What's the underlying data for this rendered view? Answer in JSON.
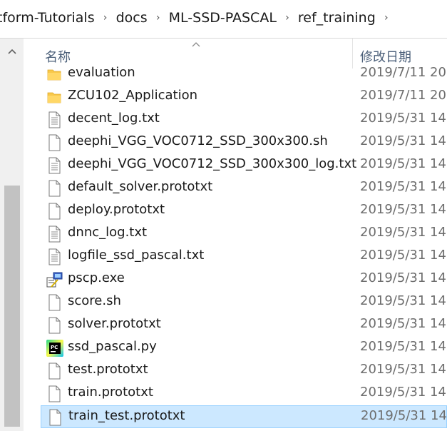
{
  "breadcrumb": [
    "tform-Tutorials",
    "docs",
    "ML-SSD-PASCAL",
    "ref_training"
  ],
  "breadcrumb_separator": "›",
  "columns": {
    "name": "名称",
    "date": "修改日期"
  },
  "files": [
    {
      "name": "evaluation",
      "date": "2019/7/11 20:",
      "icon": "folder-icon"
    },
    {
      "name": "ZCU102_Application",
      "date": "2019/7/11 20:",
      "icon": "folder-icon"
    },
    {
      "name": "decent_log.txt",
      "date": "2019/5/31 14:",
      "icon": "text-file-icon"
    },
    {
      "name": "deephi_VGG_VOC0712_SSD_300x300.sh",
      "date": "2019/5/31 14:",
      "icon": "blank-file-icon"
    },
    {
      "name": "deephi_VGG_VOC0712_SSD_300x300_log.txt",
      "date": "2019/5/31 14:",
      "icon": "text-file-icon"
    },
    {
      "name": "default_solver.prototxt",
      "date": "2019/5/31 14:",
      "icon": "blank-file-icon"
    },
    {
      "name": "deploy.prototxt",
      "date": "2019/5/31 14:",
      "icon": "blank-file-icon"
    },
    {
      "name": "dnnc_log.txt",
      "date": "2019/5/31 14:",
      "icon": "text-file-icon"
    },
    {
      "name": "logfile_ssd_pascal.txt",
      "date": "2019/5/31 14:",
      "icon": "text-file-icon"
    },
    {
      "name": "pscp.exe",
      "date": "2019/5/31 14:",
      "icon": "exe-icon"
    },
    {
      "name": "score.sh",
      "date": "2019/5/31 14:",
      "icon": "blank-file-icon"
    },
    {
      "name": "solver.prototxt",
      "date": "2019/5/31 14:",
      "icon": "blank-file-icon"
    },
    {
      "name": "ssd_pascal.py",
      "date": "2019/5/31 14:",
      "icon": "pycharm-icon"
    },
    {
      "name": "test.prototxt",
      "date": "2019/5/31 14:",
      "icon": "blank-file-icon"
    },
    {
      "name": "train.prototxt",
      "date": "2019/5/31 14:",
      "icon": "blank-file-icon"
    },
    {
      "name": "train_test.prototxt",
      "date": "2019/5/31 14:",
      "icon": "blank-file-icon"
    }
  ],
  "selected_index": 15,
  "colors": {
    "selection_bg": "#cce8ff",
    "selection_border": "#99d1ff",
    "header_text": "#4c607a",
    "folder": "#f8c84a"
  }
}
